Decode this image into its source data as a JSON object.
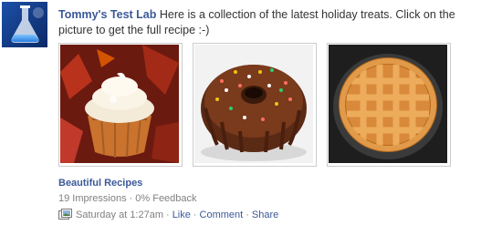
{
  "post": {
    "author": "Tommy's Test Lab",
    "message": "Here is a collection of the latest holiday treats. Click on the picture to get the full recipe :-)"
  },
  "attachment": {
    "title": "Beautiful Recipes"
  },
  "photos": [
    {
      "icon": "cupcake-photo"
    },
    {
      "icon": "bundt-cake-photo"
    },
    {
      "icon": "lattice-pie-photo"
    }
  ],
  "insights": {
    "impressions": "19 Impressions",
    "dot": "·",
    "feedback": "0% Feedback"
  },
  "meta": {
    "timestamp": "Saturday at 1:27am",
    "dot": "·",
    "like": "Like",
    "comment": "Comment",
    "share": "Share"
  },
  "colors": {
    "link": "#3b5998",
    "muted": "#808080",
    "text": "#333333"
  }
}
